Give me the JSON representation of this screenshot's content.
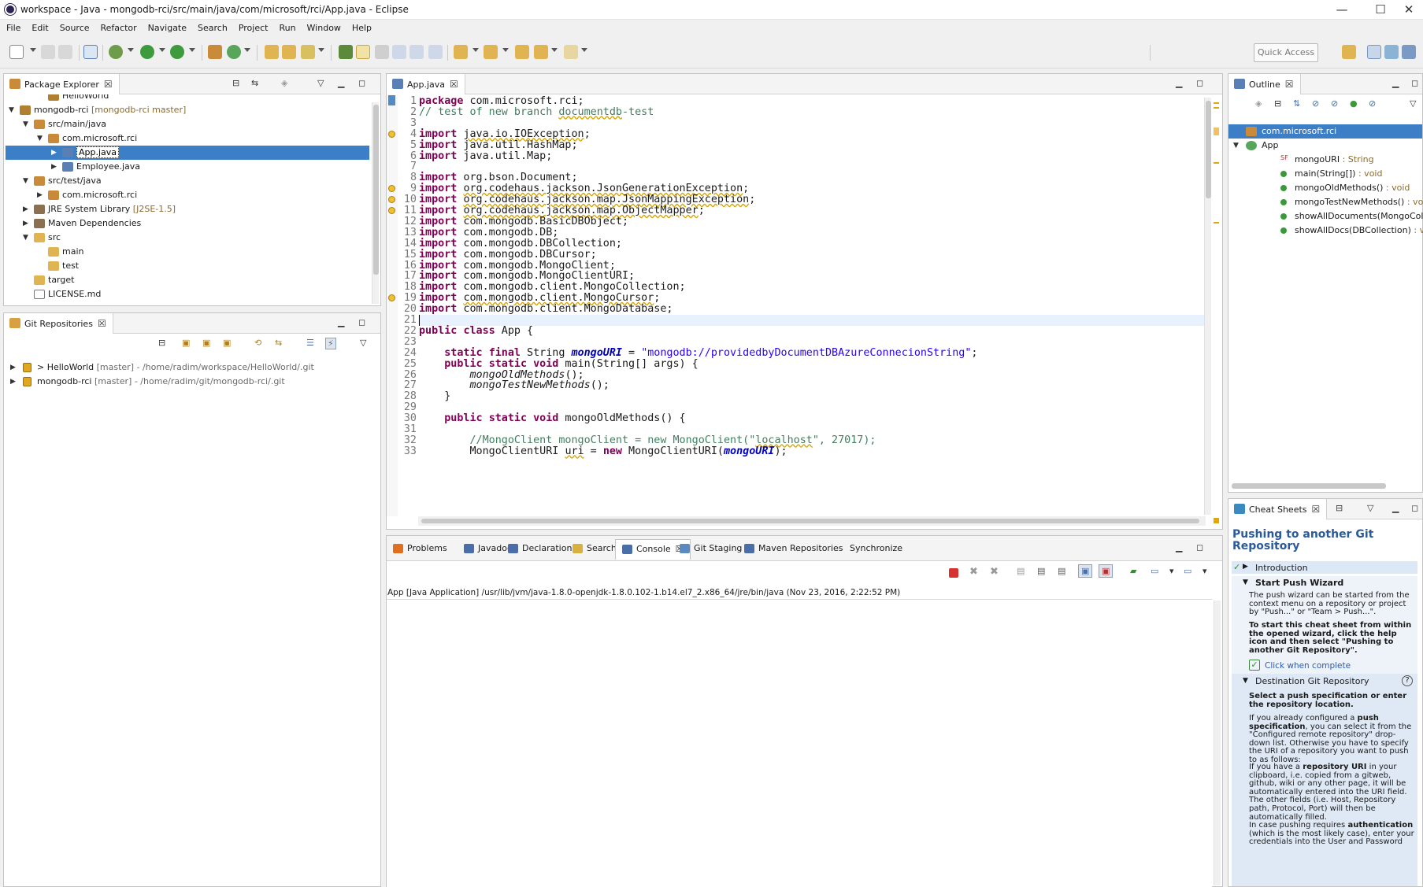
{
  "window": {
    "title": "workspace - Java - mongodb-rci/src/main/java/com/microsoft/rci/App.java - Eclipse",
    "controls": [
      "—",
      "☐",
      "✕"
    ]
  },
  "menu": [
    "File",
    "Edit",
    "Source",
    "Refactor",
    "Navigate",
    "Search",
    "Project",
    "Run",
    "Window",
    "Help"
  ],
  "toolbar": {
    "quick_access": "Quick Access"
  },
  "package_explorer": {
    "tab_label": "Package Explorer",
    "items": [
      {
        "label": "HelloWorld",
        "decoration": "",
        "indent": 2,
        "arrow": "",
        "icon": "project-icon"
      },
      {
        "label": "mongodb-rci",
        "decoration": "[mongodb-rci master]",
        "indent": 0,
        "arrow": "▼",
        "icon": "project-icon"
      },
      {
        "label": "src/main/java",
        "decoration": "",
        "indent": 1,
        "arrow": "▼",
        "icon": "source-folder-icon"
      },
      {
        "label": "com.microsoft.rci",
        "decoration": "",
        "indent": 2,
        "arrow": "▼",
        "icon": "package-icon"
      },
      {
        "label": "App.java",
        "decoration": "",
        "indent": 3,
        "arrow": "▶",
        "icon": "java-file-icon",
        "selected": true
      },
      {
        "label": "Employee.java",
        "decoration": "",
        "indent": 3,
        "arrow": "▶",
        "icon": "java-file-icon"
      },
      {
        "label": "src/test/java",
        "decoration": "",
        "indent": 1,
        "arrow": "▼",
        "icon": "source-folder-icon"
      },
      {
        "label": "com.microsoft.rci",
        "decoration": "",
        "indent": 2,
        "arrow": "▶",
        "icon": "package-icon"
      },
      {
        "label": "JRE System Library",
        "decoration": "[J2SE-1.5]",
        "indent": 1,
        "arrow": "▶",
        "icon": "library-icon"
      },
      {
        "label": "Maven Dependencies",
        "decoration": "",
        "indent": 1,
        "arrow": "▶",
        "icon": "library-icon"
      },
      {
        "label": "src",
        "decoration": "",
        "indent": 1,
        "arrow": "▼",
        "icon": "folder-icon"
      },
      {
        "label": "main",
        "decoration": "",
        "indent": 2,
        "arrow": "",
        "icon": "folder-icon"
      },
      {
        "label": "test",
        "decoration": "",
        "indent": 2,
        "arrow": "",
        "icon": "folder-icon"
      },
      {
        "label": "target",
        "decoration": "",
        "indent": 1,
        "arrow": "",
        "icon": "folder-icon"
      },
      {
        "label": "LICENSE.md",
        "decoration": "",
        "indent": 1,
        "arrow": "",
        "icon": "file-icon"
      }
    ]
  },
  "git_repositories": {
    "tab_label": "Git Repositories",
    "items": [
      {
        "label": "> HelloWorld",
        "decoration": "[master] - /home/radim/workspace/HelloWorld/.git"
      },
      {
        "label": "mongodb-rci",
        "decoration": "[master] - /home/radim/git/mongodb-rci/.git"
      }
    ]
  },
  "editor": {
    "tab_label": "App.java",
    "lines": [
      {
        "n": "1",
        "code": "<span class=\"kw\">package</span> com.microsoft.rci;"
      },
      {
        "n": "2",
        "code": "<span class=\"cm\">// test of new branch <span class=\"warnu\">documentdb</span>-test</span>"
      },
      {
        "n": "3",
        "code": ""
      },
      {
        "n": "4",
        "code": "<span class=\"kw\">import</span> <span class=\"warnu\">java.io.IOException</span>;",
        "warn": true
      },
      {
        "n": "5",
        "code": "<span class=\"kw\">import</span> java.util.HashMap;"
      },
      {
        "n": "6",
        "code": "<span class=\"kw\">import</span> java.util.Map;"
      },
      {
        "n": "7",
        "code": ""
      },
      {
        "n": "8",
        "code": "<span class=\"kw\">import</span> org.bson.Document;"
      },
      {
        "n": "9",
        "code": "<span class=\"kw\">import</span> <span class=\"warnu\">org.codehaus.jackson.JsonGenerationException</span>;",
        "warn": true
      },
      {
        "n": "10",
        "code": "<span class=\"kw\">import</span> <span class=\"warnu\">org.codehaus.jackson.map.JsonMappingException</span>;",
        "warn": true
      },
      {
        "n": "11",
        "code": "<span class=\"kw\">import</span> <span class=\"warnu\">org.codehaus.jackson.map.ObjectMapper</span>;",
        "warn": true
      },
      {
        "n": "12",
        "code": "<span class=\"kw\">import</span> com.mongodb.BasicDBObject;"
      },
      {
        "n": "13",
        "code": "<span class=\"kw\">import</span> com.mongodb.DB;"
      },
      {
        "n": "14",
        "code": "<span class=\"kw\">import</span> com.mongodb.DBCollection;"
      },
      {
        "n": "15",
        "code": "<span class=\"kw\">import</span> com.mongodb.DBCursor;"
      },
      {
        "n": "16",
        "code": "<span class=\"kw\">import</span> com.mongodb.MongoClient;"
      },
      {
        "n": "17",
        "code": "<span class=\"kw\">import</span> com.mongodb.MongoClientURI;"
      },
      {
        "n": "18",
        "code": "<span class=\"kw\">import</span> com.mongodb.client.MongoCollection;"
      },
      {
        "n": "19",
        "code": "<span class=\"kw\">import</span> <span class=\"warnu\">com.mongodb.client.MongoCursor</span>;",
        "warn": true
      },
      {
        "n": "20",
        "code": "<span class=\"kw\">import</span> com.mongodb.client.MongoDatabase;"
      },
      {
        "n": "21",
        "code": "",
        "current": true
      },
      {
        "n": "22",
        "code": "<span class=\"kw\">public</span> <span class=\"kw\">class</span> App {"
      },
      {
        "n": "23",
        "code": ""
      },
      {
        "n": "24",
        "code": "    <span class=\"kw\">static</span> <span class=\"kw\">final</span> String <span class=\"fld\" style=\"font-weight:bold\">mongoURI</span> = <span class=\"str\">\"mongodb://providedbyDocumentDBAzureConnecionString\"</span>;"
      },
      {
        "n": "25",
        "code": "    <span class=\"kw\">public</span> <span class=\"kw\">static</span> <span class=\"kw\">void</span> main(String[] args) {"
      },
      {
        "n": "26",
        "code": "        <span class=\"ital\">mongoOldMethods</span>();"
      },
      {
        "n": "27",
        "code": "        <span class=\"ital\">mongoTestNewMethods</span>();"
      },
      {
        "n": "28",
        "code": "    }"
      },
      {
        "n": "29",
        "code": ""
      },
      {
        "n": "30",
        "code": "    <span class=\"kw\">public</span> <span class=\"kw\">static</span> <span class=\"kw\">void</span> mongoOldMethods() {"
      },
      {
        "n": "31",
        "code": ""
      },
      {
        "n": "32",
        "code": "        <span class=\"cm\">//MongoClient mongoClient = new MongoClient(\"<span class=\"warnu\">localhost</span>\", 27017);</span>"
      },
      {
        "n": "33",
        "code": "        MongoClientURI <span class=\"warnu\">uri</span> = <span class=\"kw\">new</span> MongoClientURI(<span class=\"fld\" style=\"font-weight:bold\">mongoURI</span>);"
      }
    ]
  },
  "bottom_tabs": [
    "Problems",
    "Javadoc",
    "Declaration",
    "Search",
    "Console",
    "Git Staging",
    "Maven Repositories",
    "Synchronize"
  ],
  "console": {
    "header": "App [Java Application] /usr/lib/jvm/java-1.8.0-openjdk-1.8.0.102-1.b14.el7_2.x86_64/jre/bin/java (Nov 23, 2016, 2:22:52 PM)"
  },
  "outline": {
    "tab_label": "Outline",
    "items": [
      {
        "label": "com.microsoft.rci",
        "type": "",
        "indent": 0,
        "selected": true
      },
      {
        "label": "App",
        "type": "",
        "indent": 0,
        "arrow": "▼"
      },
      {
        "label": "mongoURI",
        "type": " : String",
        "indent": 1,
        "mod": "SF"
      },
      {
        "label": "main(String[])",
        "type": " : void",
        "indent": 1,
        "mod": "S"
      },
      {
        "label": "mongoOldMethods()",
        "type": " : void",
        "indent": 1,
        "mod": "S"
      },
      {
        "label": "mongoTestNewMethods()",
        "type": " : void",
        "indent": 1,
        "mod": "S"
      },
      {
        "label": "showAllDocuments(MongoCollection<",
        "type": "",
        "indent": 1,
        "mod": "S"
      },
      {
        "label": "showAllDocs(DBCollection)",
        "type": " : void",
        "indent": 1,
        "mod": "S"
      }
    ]
  },
  "cheat_sheet": {
    "tab_label": "Cheat Sheets",
    "title": "Pushing to another Git Repository",
    "intro": "Introduction",
    "step1_title": "Start Push Wizard",
    "step1_p1": "The push wizard can be started from the context menu on a repository or project by \"Push...\" or \"Team > Push...\".",
    "step1_p2": "To start this cheat sheet from within the opened wizard, click the help icon and then select \"Pushing to another Git Repository\".",
    "click_complete": "Click when complete",
    "step2_title": "Destination Git Repository",
    "step2_p1": "Select a push specification or enter the repository location.",
    "step2_p2a": "If you already configured a ",
    "step2_p2b": "push specification",
    "step2_p2c": ", you can select it from the \"Configured remote repository\" drop-down list. Otherwise you have to specify the URI of a repository you want to push to as follows:",
    "step2_p3a": "If you have a ",
    "step2_p3b": "repository URI",
    "step2_p3c": " in your clipboard, i.e. copied from a gitweb, github, wiki or any other page, it will be automatically entered into the URI field. The other fields (i.e. Host, Repository path, Protocol, Port) will then be automatically filled.",
    "step2_p4a": "In case pushing requires ",
    "step2_p4b": "authentication",
    "step2_p4c": " (which is the most likely case), enter your credentials into the User and Password"
  }
}
